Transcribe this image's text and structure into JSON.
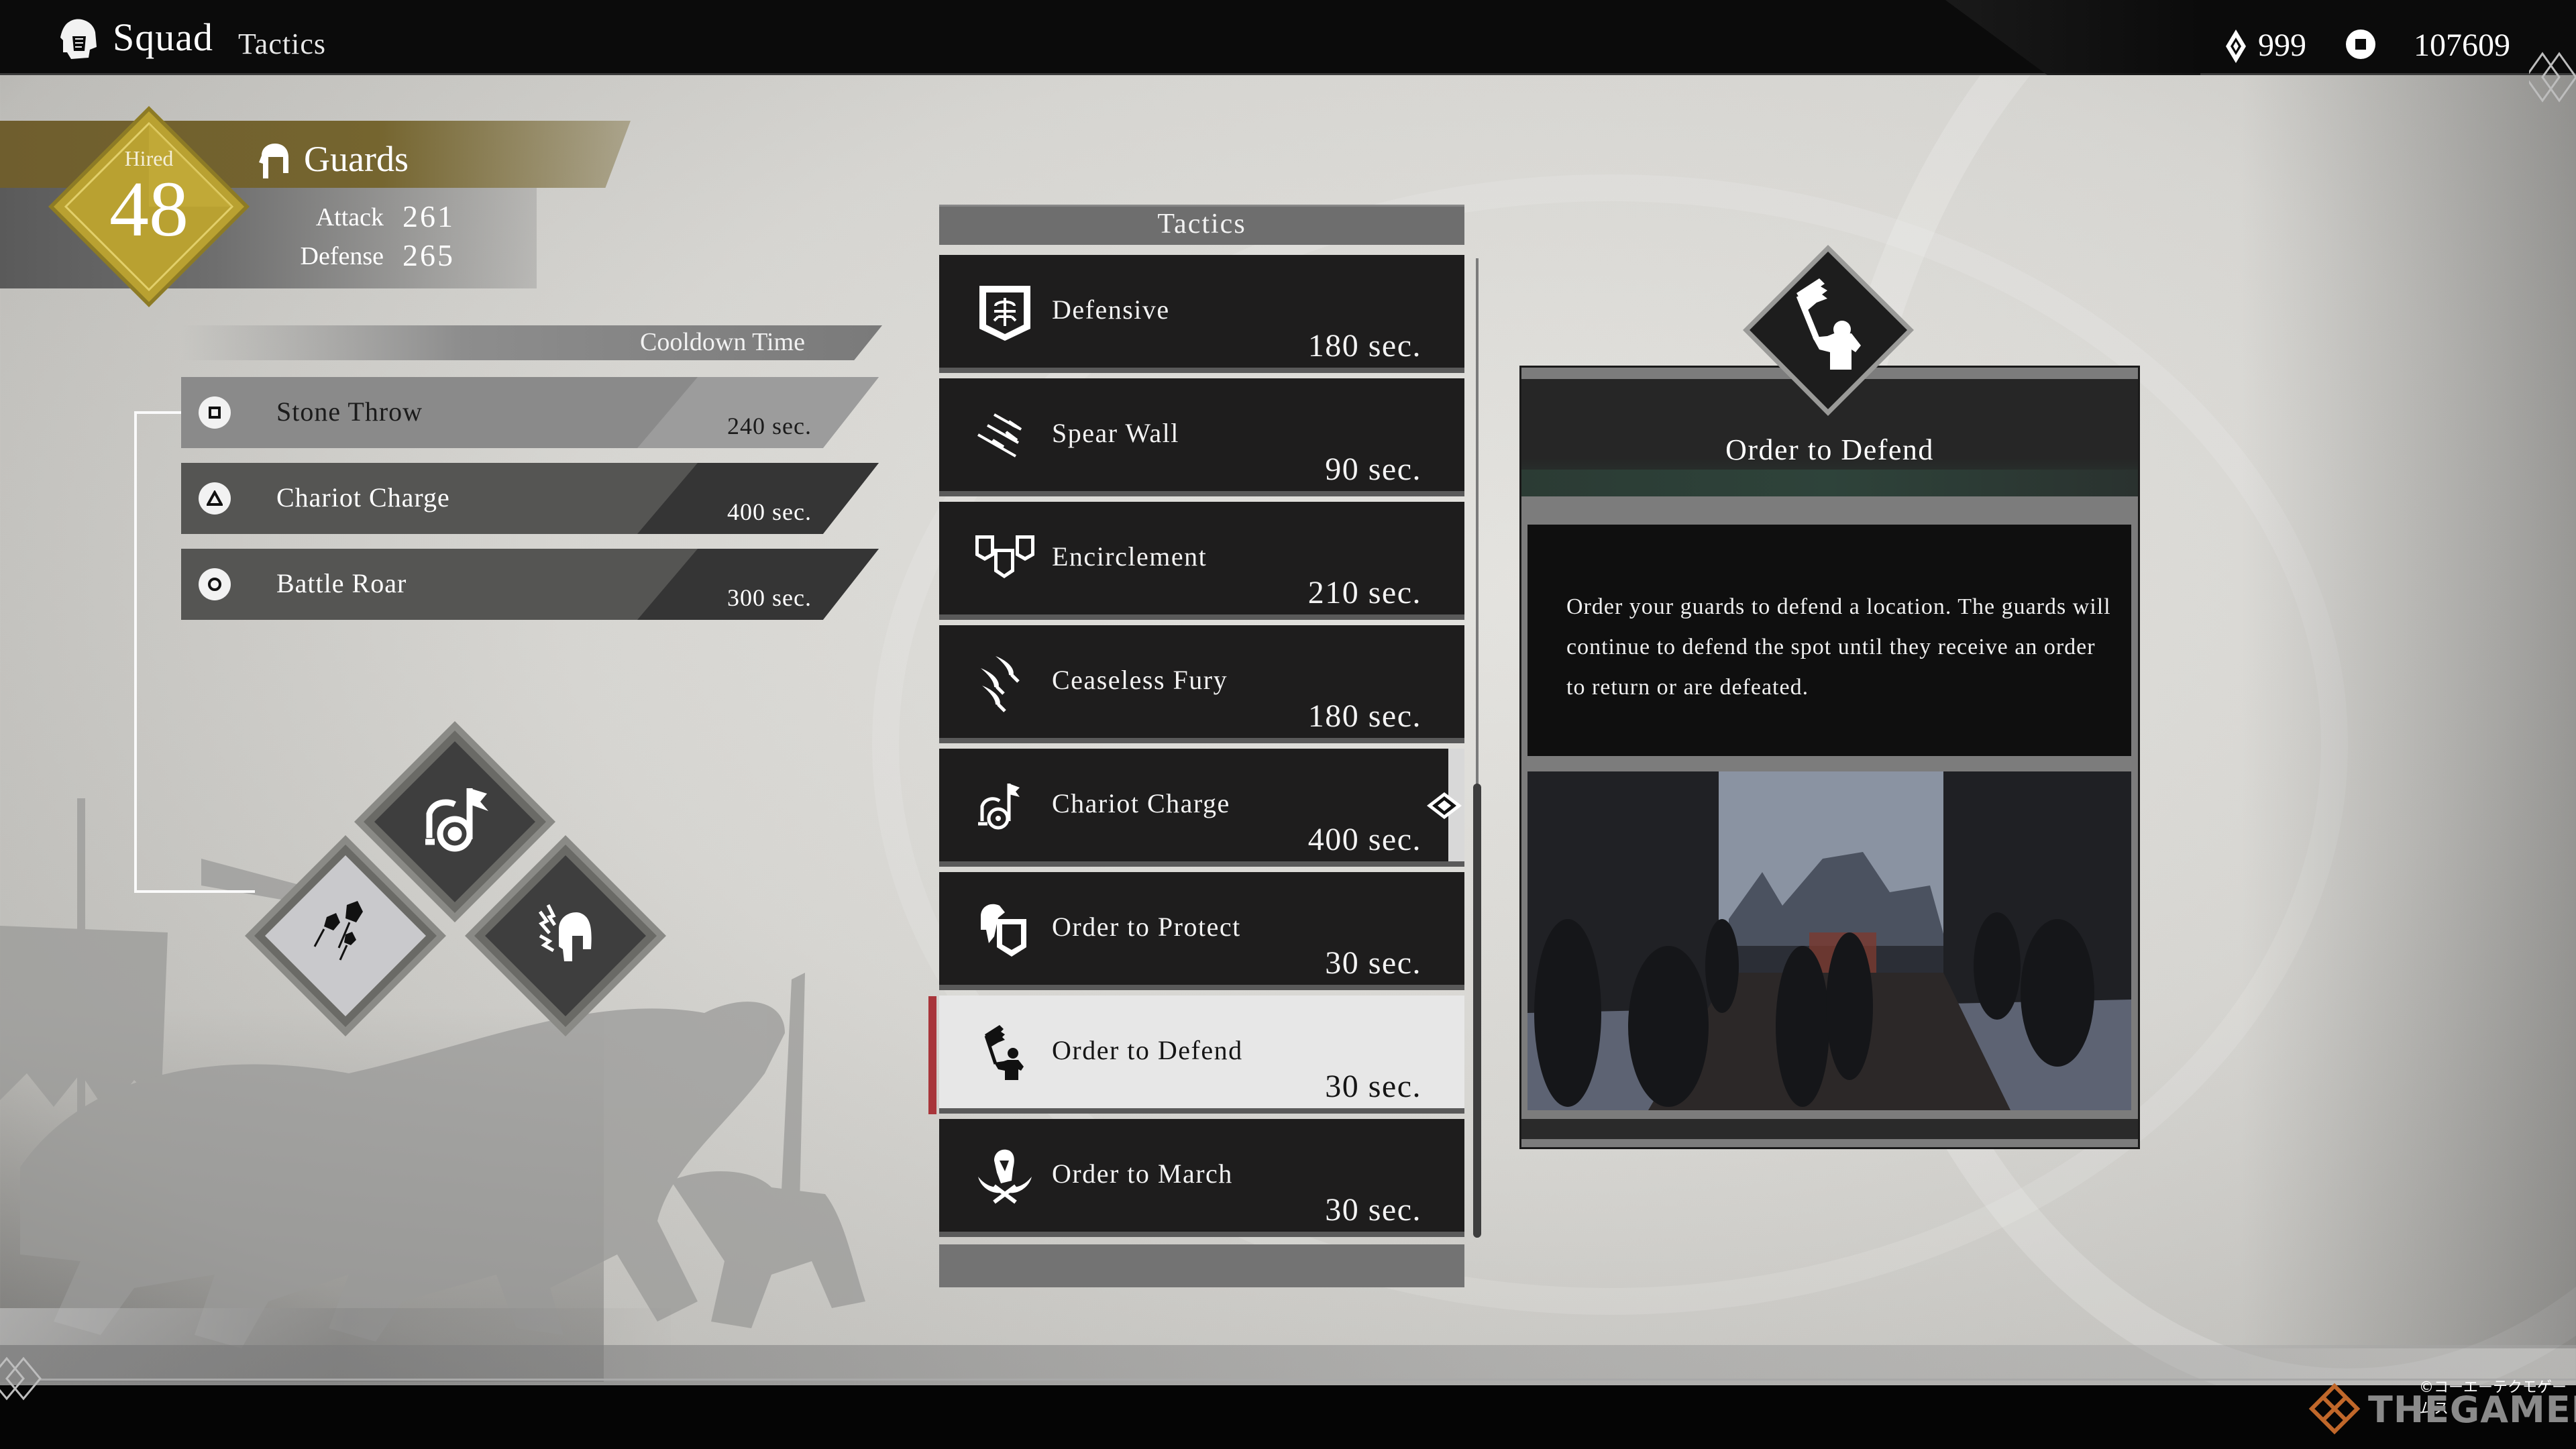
{
  "header": {
    "title": "Squad",
    "subtitle": "Tactics",
    "title_icon": "helmet-icon",
    "currencies": [
      {
        "icon": "gem-icon",
        "value": "999"
      },
      {
        "icon": "coin-icon",
        "value": "107609"
      }
    ]
  },
  "squad": {
    "hired_label": "Hired",
    "hired_count": "48",
    "name": "Guards",
    "icon": "helmet-icon",
    "accent_color": "#b09a36",
    "stats": [
      {
        "label": "Attack",
        "value": "261"
      },
      {
        "label": "Defense",
        "value": "265"
      }
    ]
  },
  "cooldown": {
    "header": "Cooldown Time",
    "skills": [
      {
        "button": "square",
        "name": "Stone Throw",
        "time": "240 sec.",
        "highlighted": true
      },
      {
        "button": "triangle",
        "name": "Chariot Charge",
        "time": "400 sec.",
        "highlighted": false
      },
      {
        "button": "circle",
        "name": "Battle Roar",
        "time": "300 sec.",
        "highlighted": false
      }
    ]
  },
  "skill_diamonds": [
    {
      "slot": "top",
      "icon": "chariot-icon",
      "selected": false
    },
    {
      "slot": "left",
      "icon": "stone-throw-icon",
      "selected": true
    },
    {
      "slot": "right",
      "icon": "battle-roar-icon",
      "selected": false
    }
  ],
  "tactics": {
    "header": "Tactics",
    "items": [
      {
        "name": "Defensive",
        "time": "180 sec.",
        "icon": "shield-icon"
      },
      {
        "name": "Spear Wall",
        "time": "90 sec.",
        "icon": "spears-icon"
      },
      {
        "name": "Encirclement",
        "time": "210 sec.",
        "icon": "shields-triple-icon"
      },
      {
        "name": "Ceaseless Fury",
        "time": "180 sec.",
        "icon": "swords-icon"
      },
      {
        "name": "Chariot Charge",
        "time": "400 sec.",
        "icon": "chariot-icon",
        "equipped": true
      },
      {
        "name": "Order to Protect",
        "time": "30 sec.",
        "icon": "soldier-shield-icon"
      },
      {
        "name": "Order to Defend",
        "time": "30 sec.",
        "icon": "flag-bearer-icon",
        "selected": true
      },
      {
        "name": "Order to March",
        "time": "30 sec.",
        "icon": "soldier-swords-icon"
      }
    ],
    "scroll_position": 0.54,
    "selected_accent": "#a8353a"
  },
  "detail": {
    "title": "Order to Defend",
    "icon": "flag-bearer-icon",
    "description": "Order your guards to defend a location. The guards will continue to defend the spot until they receive an order to return or are defeated.",
    "preview_alt": "battle-preview-image"
  },
  "watermark": {
    "copyright": "©コーエーテクモゲームス",
    "brand": "THEGAMER"
  }
}
